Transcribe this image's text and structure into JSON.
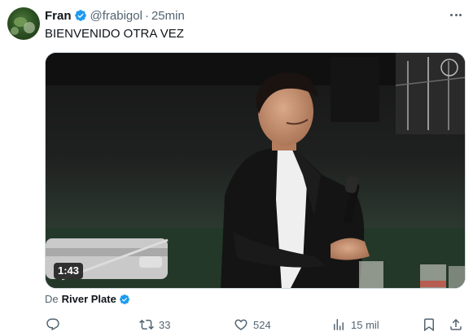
{
  "tweet": {
    "author_name": "Fran",
    "handle": "@frabigol",
    "separator": "·",
    "time": "25min",
    "text": "BIENVENIDO OTRA VEZ",
    "verified_color": "#1d9bf0"
  },
  "media": {
    "type": "video",
    "duration": "1:43"
  },
  "attribution": {
    "prefix": "De",
    "account": "River Plate"
  },
  "actions": {
    "reply_count": "",
    "retweet_count": "33",
    "like_count": "524",
    "views_count": "15 mil"
  },
  "icons": {
    "verified": "verified-badge-icon",
    "more": "more-dots-icon",
    "reply": "reply-icon",
    "retweet": "retweet-icon",
    "like": "heart-icon",
    "views": "views-chart-icon",
    "bookmark": "bookmark-icon",
    "share": "share-icon"
  },
  "colors": {
    "text_primary": "#0f1419",
    "text_secondary": "#536471",
    "accent": "#1d9bf0",
    "border": "#cfd9de"
  }
}
